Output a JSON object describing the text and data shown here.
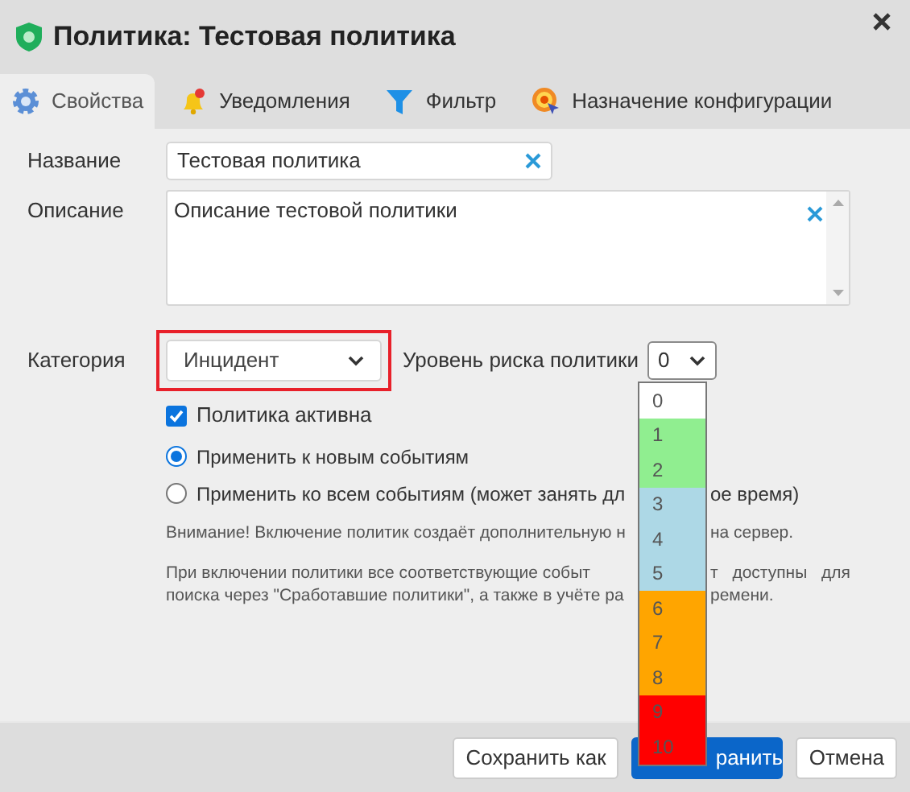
{
  "window": {
    "title": "Политика: Тестовая политика"
  },
  "tabs": [
    {
      "label": "Свойства",
      "selected": true
    },
    {
      "label": "Уведомления",
      "selected": false
    },
    {
      "label": "Фильтр",
      "selected": false
    },
    {
      "label": "Назначение конфигурации",
      "selected": false
    }
  ],
  "form": {
    "name": {
      "label": "Название",
      "value": "Тестовая политика"
    },
    "description": {
      "label": "Описание",
      "value": "Описание тестовой политики"
    },
    "category": {
      "label": "Категория",
      "value": "Инцидент",
      "highlighted": true
    },
    "risk_level": {
      "label": "Уровень риска политики",
      "value": "0",
      "expanded": true,
      "options": [
        {
          "label": "0",
          "color": "#ffffff"
        },
        {
          "label": "1",
          "color": "#90ee90"
        },
        {
          "label": "2",
          "color": "#90ee90"
        },
        {
          "label": "3",
          "color": "#add8e6"
        },
        {
          "label": "4",
          "color": "#add8e6"
        },
        {
          "label": "5",
          "color": "#add8e6"
        },
        {
          "label": "6",
          "color": "#ffa500"
        },
        {
          "label": "7",
          "color": "#ffa500"
        },
        {
          "label": "8",
          "color": "#ffa500"
        },
        {
          "label": "9",
          "color": "#ff0000"
        },
        {
          "label": "10",
          "color": "#ff0000"
        }
      ]
    },
    "active": {
      "label": "Политика активна",
      "checked": true
    },
    "apply_options": [
      {
        "parts": [
          "Применить к новым событиям"
        ],
        "selected": true
      },
      {
        "parts": [
          "Применить ко всем событиям (может занять дл",
          "ое время)"
        ],
        "selected": false
      }
    ],
    "note": {
      "parts": [
        "Внимание! Включение политик создаёт дополнительную н",
        "на сервер."
      ]
    },
    "paragraph_lines": [
      {
        "parts": [
          "При включении политики все соответствующие событ",
          "т доступны для"
        ]
      },
      {
        "parts": [
          "поиска через \"Сработавшие политики\", а также в учёте ра",
          "ремени."
        ]
      }
    ]
  },
  "buttons": [
    {
      "label": "Сохранить как",
      "primary": false
    },
    {
      "label": "ранить",
      "primary": true
    },
    {
      "label": "Отмена",
      "primary": false
    }
  ]
}
